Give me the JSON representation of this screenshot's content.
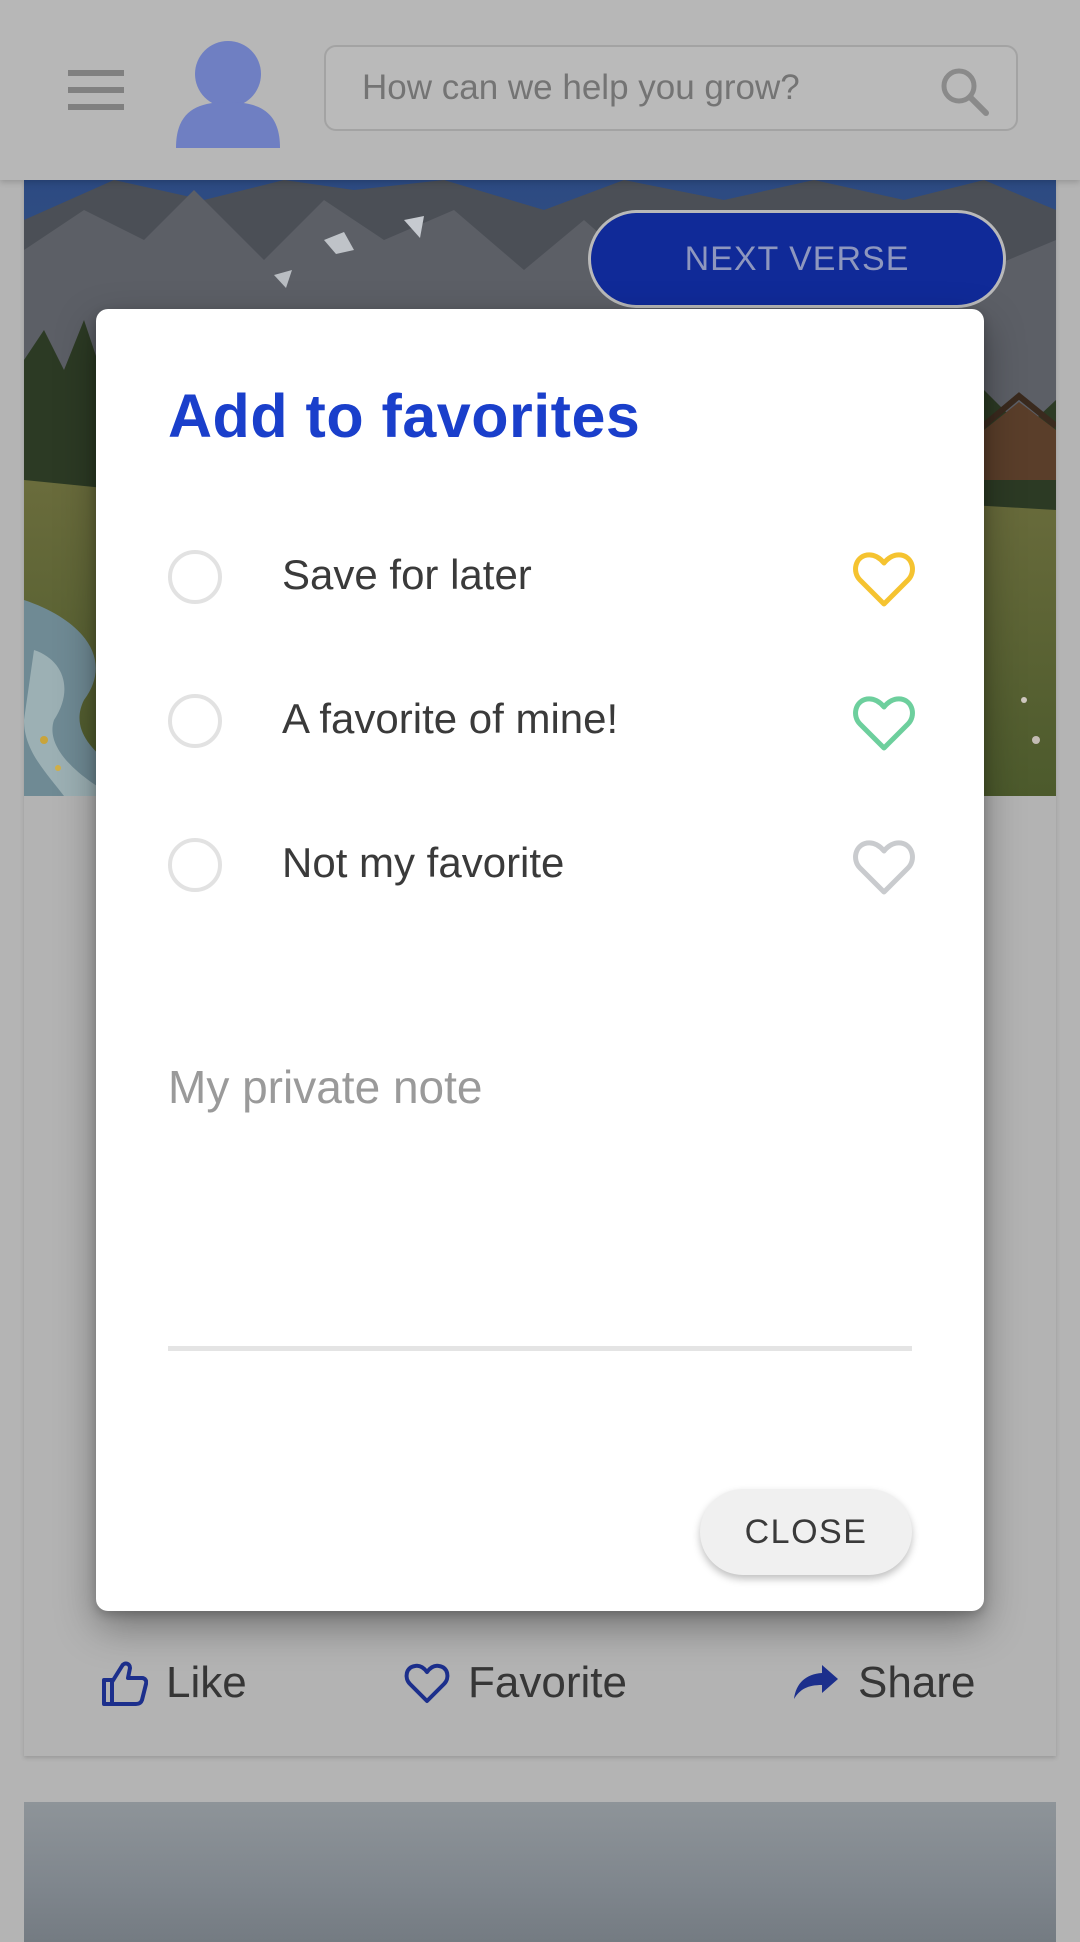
{
  "search": {
    "placeholder": "How can we help you grow?"
  },
  "hero": {
    "next_button_label": "NEXT VERSE"
  },
  "actions": [
    {
      "label": "Like",
      "icon": "thumbs-up-icon"
    },
    {
      "label": "Favorite",
      "icon": "heart-outline-icon"
    },
    {
      "label": "Share",
      "icon": "share-arrow-icon"
    }
  ],
  "dialog": {
    "title": "Add to favorites",
    "options": [
      {
        "label": "Save for later",
        "heart_color": "#f5c330",
        "selected": false
      },
      {
        "label": "A favorite of mine!",
        "heart_color": "#6dcf9d",
        "selected": false
      },
      {
        "label": "Not my favorite",
        "heart_color": "#c9cbce",
        "selected": false
      }
    ],
    "note_placeholder": "My private note",
    "close_label": "CLOSE"
  },
  "colors": {
    "accent": "#1a3fcb",
    "brand_dark": "#102a98",
    "overlay": "#b4b4b4"
  }
}
